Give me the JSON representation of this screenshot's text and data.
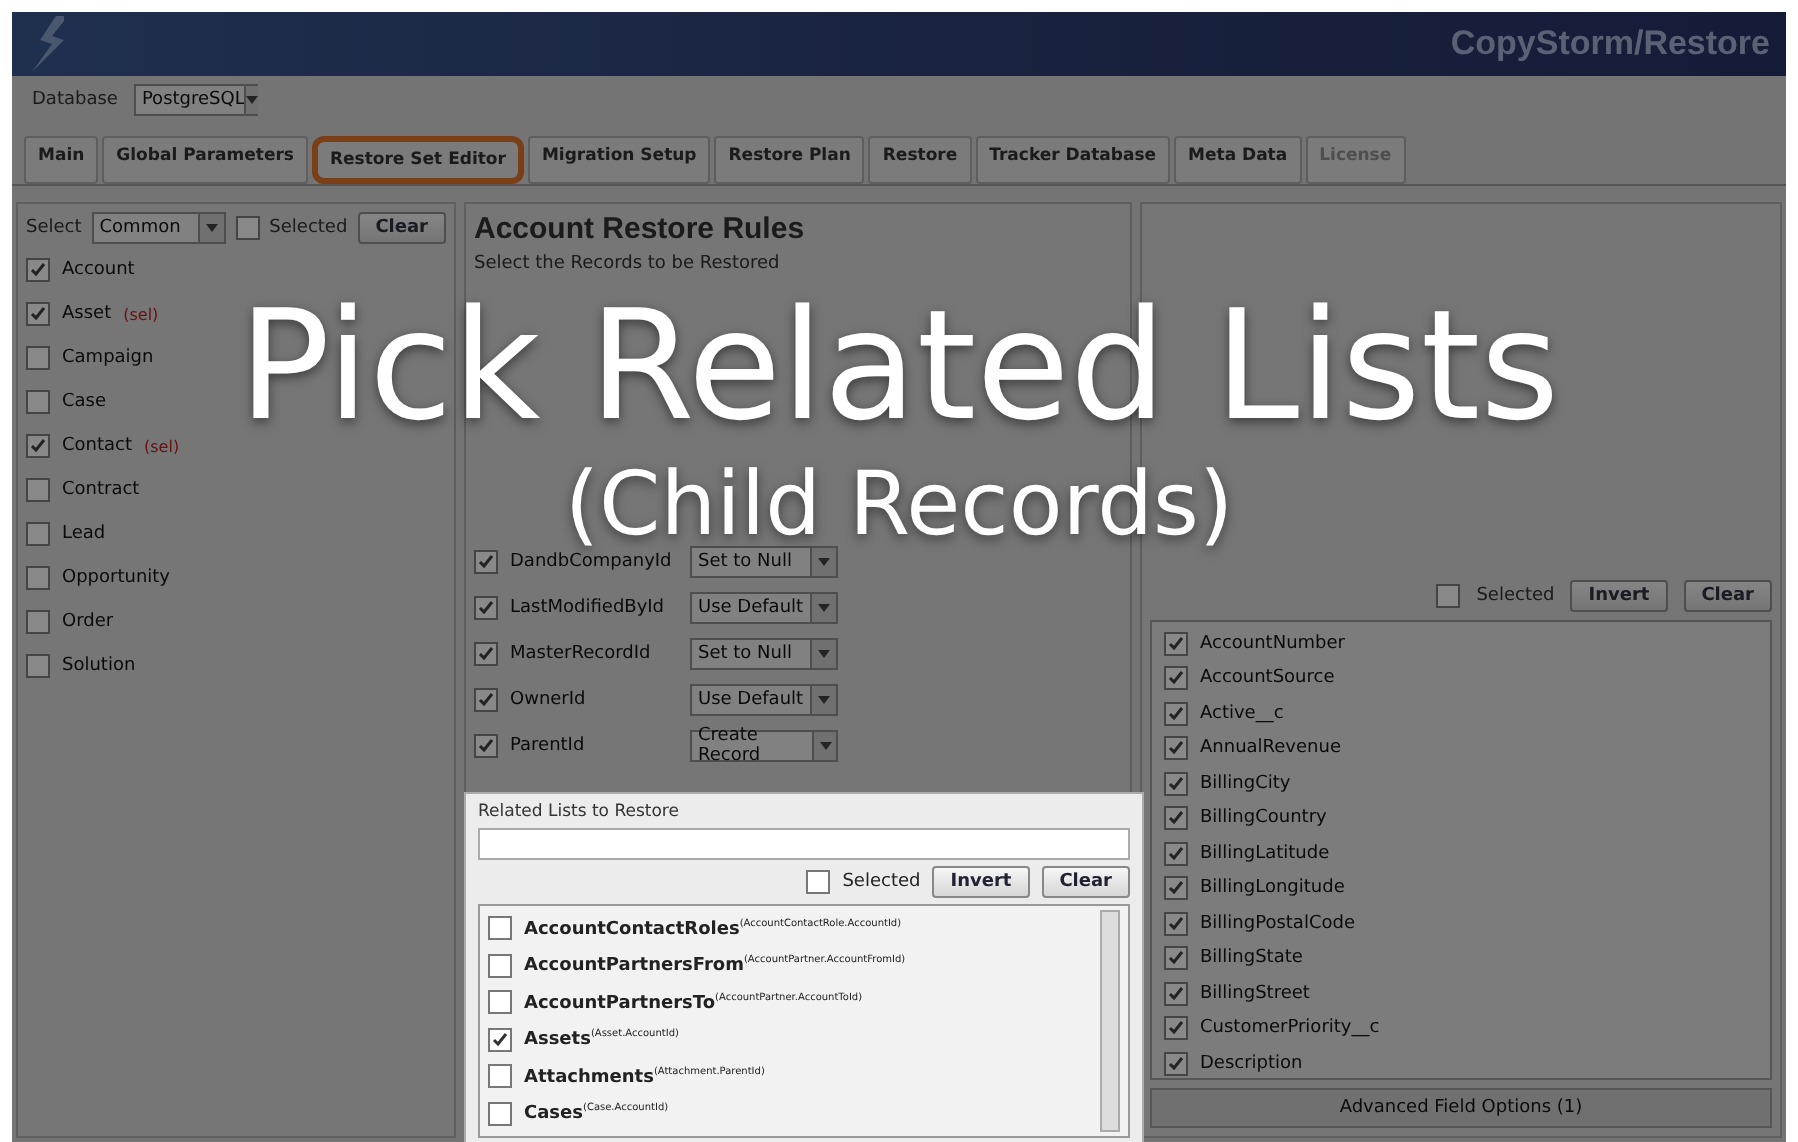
{
  "banner": {
    "title": "CopyStorm/Restore"
  },
  "database": {
    "label": "Database",
    "value": "PostgreSQL"
  },
  "tabs": [
    {
      "label": "Main",
      "selected": false,
      "disabled": false
    },
    {
      "label": "Global Parameters",
      "selected": false,
      "disabled": false
    },
    {
      "label": "Restore Set Editor",
      "selected": true,
      "disabled": false
    },
    {
      "label": "Migration Setup",
      "selected": false,
      "disabled": false
    },
    {
      "label": "Restore Plan",
      "selected": false,
      "disabled": false
    },
    {
      "label": "Restore",
      "selected": false,
      "disabled": false
    },
    {
      "label": "Tracker Database",
      "selected": false,
      "disabled": false
    },
    {
      "label": "Meta Data",
      "selected": false,
      "disabled": false
    },
    {
      "label": "License",
      "selected": false,
      "disabled": true
    }
  ],
  "objects_panel": {
    "select_label": "Select",
    "select_value": "Common",
    "selected_label": "Selected",
    "selected_checked": false,
    "clear": "Clear",
    "items": [
      {
        "name": "Account",
        "checked": true
      },
      {
        "name": "Asset",
        "checked": true,
        "tag": "(sel)"
      },
      {
        "name": "Campaign",
        "checked": false
      },
      {
        "name": "Case",
        "checked": false
      },
      {
        "name": "Contact",
        "checked": true,
        "tag": "(sel)"
      },
      {
        "name": "Contract",
        "checked": false
      },
      {
        "name": "Lead",
        "checked": false
      },
      {
        "name": "Opportunity",
        "checked": false
      },
      {
        "name": "Order",
        "checked": false
      },
      {
        "name": "Solution",
        "checked": false
      }
    ]
  },
  "rules": {
    "title": "Account Restore Rules",
    "subtitle": "Select the Records to be Restored",
    "references": [
      {
        "name": "DandbCompanyId",
        "checked": true,
        "action": "Set to Null"
      },
      {
        "name": "LastModifiedById",
        "checked": true,
        "action": "Use Default"
      },
      {
        "name": "MasterRecordId",
        "checked": true,
        "action": "Set to Null"
      },
      {
        "name": "OwnerId",
        "checked": true,
        "action": "Use Default"
      },
      {
        "name": "ParentId",
        "checked": true,
        "action": "Create Record"
      }
    ]
  },
  "fields_panel": {
    "selected_label": "Selected",
    "selected_checked": false,
    "invert": "Invert",
    "clear": "Clear",
    "fields": [
      {
        "name": "AccountNumber",
        "checked": true
      },
      {
        "name": "AccountSource",
        "checked": true
      },
      {
        "name": "Active__c",
        "checked": true
      },
      {
        "name": "AnnualRevenue",
        "checked": true
      },
      {
        "name": "BillingCity",
        "checked": true
      },
      {
        "name": "BillingCountry",
        "checked": true
      },
      {
        "name": "BillingLatitude",
        "checked": true
      },
      {
        "name": "BillingLongitude",
        "checked": true
      },
      {
        "name": "BillingPostalCode",
        "checked": true
      },
      {
        "name": "BillingState",
        "checked": true
      },
      {
        "name": "BillingStreet",
        "checked": true
      },
      {
        "name": "CustomerPriority__c",
        "checked": true
      },
      {
        "name": "Description",
        "checked": true
      }
    ],
    "advanced": "Advanced Field Options (1)"
  },
  "related_lists": {
    "title": "Related Lists to Restore",
    "selected_label": "Selected",
    "selected_checked": false,
    "invert": "Invert",
    "clear": "Clear",
    "items": [
      {
        "name": "AccountContactRoles$^{(AccountContactRole.AccountId)}$",
        "checked": false
      },
      {
        "name": "AccountPartnersFrom$^{(AccountPartner.AccountFromId)}$",
        "checked": false
      },
      {
        "name": "AccountPartnersTo$^{(AccountPartner.AccountToId)}$",
        "checked": false
      },
      {
        "name": "Assets$^{(Asset.AccountId)}$",
        "checked": true
      },
      {
        "name": "Attachments$^{(Attachment.ParentId)}$",
        "checked": false
      },
      {
        "name": "Cases$^{(Case.AccountId)}$",
        "checked": false
      }
    ]
  },
  "overlay": {
    "title": "Pick Related Lists",
    "subtitle": "(Child Records)"
  }
}
